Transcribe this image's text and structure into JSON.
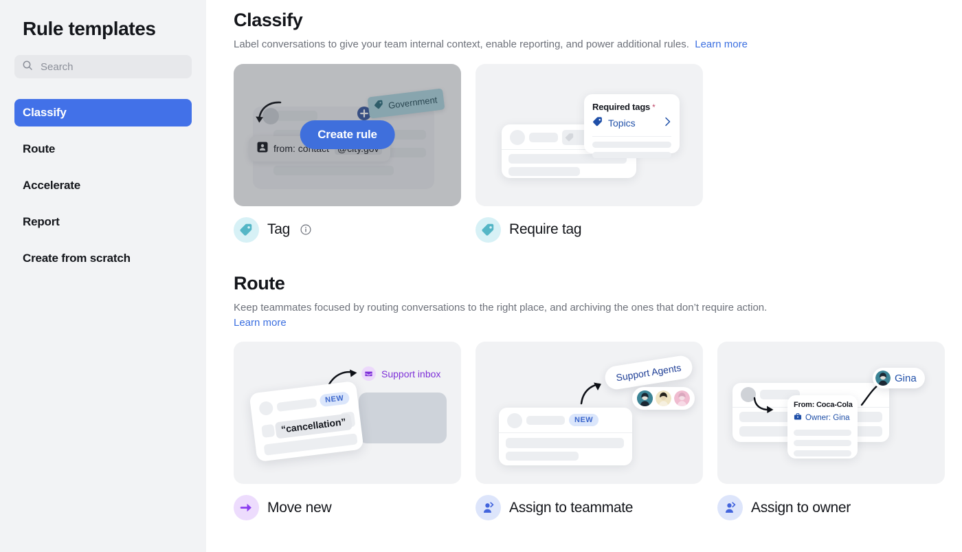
{
  "sidebar": {
    "title": "Rule templates",
    "search": {
      "placeholder": "Search",
      "value": "",
      "icon": "search-icon"
    },
    "items": [
      {
        "label": "Classify",
        "active": true
      },
      {
        "label": "Route",
        "active": false
      },
      {
        "label": "Accelerate",
        "active": false
      },
      {
        "label": "Report",
        "active": false
      },
      {
        "label": "Create from scratch",
        "active": false
      }
    ]
  },
  "sections": [
    {
      "id": "classify",
      "title": "Classify",
      "description": "Label conversations to give your team internal context, enable reporting, and power additional rules.",
      "learn_more": "Learn more",
      "cards": [
        {
          "id": "tag",
          "label": "Tag",
          "has_info_icon": true,
          "icon": "tag-icon",
          "icon_color": "#54b6c6",
          "icon_bg": "#d7f1f6",
          "hovered": true,
          "overlay_button": "Create rule",
          "art": {
            "tag_chip": "Government",
            "from_line": "from: contact",
            "from_domain": "@city.gov",
            "from_icon": "contact-icon",
            "plus_icon": "plus-icon"
          }
        },
        {
          "id": "require-tag",
          "label": "Require tag",
          "has_info_icon": false,
          "icon": "tag-icon",
          "icon_color": "#54b6c6",
          "icon_bg": "#d7f1f6",
          "hovered": false,
          "art": {
            "popover_title": "Required tags",
            "popover_required_mark": "*",
            "popover_row": "Topics",
            "popover_row_icon": "tag-icon",
            "chevron": "chevron-right-icon"
          }
        }
      ]
    },
    {
      "id": "route",
      "title": "Route",
      "description": "Keep teammates focused by routing conversations to the right place, and archiving the ones that don’t require action.",
      "learn_more": "Learn more",
      "cards": [
        {
          "id": "move-new",
          "label": "Move new",
          "has_info_icon": false,
          "icon": "arrow-right-icon",
          "icon_color": "#8b3ef0",
          "icon_bg": "#eddcfd",
          "hovered": false,
          "art": {
            "inbox_pill": "Support inbox",
            "inbox_icon": "inbox-icon",
            "badge": "NEW",
            "quote": "“cancellation”"
          }
        },
        {
          "id": "assign-to-teammate",
          "label": "Assign to teammate",
          "has_info_icon": false,
          "icon": "assign-person-icon",
          "icon_color": "#4264dd",
          "icon_bg": "#dde5fb",
          "hovered": false,
          "art": {
            "team_pill": "Support Agents",
            "badge": "NEW",
            "avatars": [
              "avatar-teal",
              "avatar-cream",
              "avatar-pink"
            ]
          }
        },
        {
          "id": "assign-to-owner",
          "label": "Assign to owner",
          "has_info_icon": false,
          "icon": "assign-person-icon",
          "icon_color": "#4264dd",
          "icon_bg": "#dde5fb",
          "hovered": false,
          "art": {
            "from_line": "From: Coca-Cola",
            "owner_line": "Owner: Gina",
            "owner_icon": "briefcase-icon",
            "owner_pill": "Gina",
            "owner_avatar": "avatar-teal"
          }
        }
      ]
    }
  ],
  "colors": {
    "accent_blue": "#4271e8",
    "link_blue": "#3b6fe0",
    "sidebar_bg": "#f2f3f5",
    "card_bg": "#f1f2f4",
    "tag_teal": "#54b6c6",
    "purple": "#8b3ef0"
  }
}
